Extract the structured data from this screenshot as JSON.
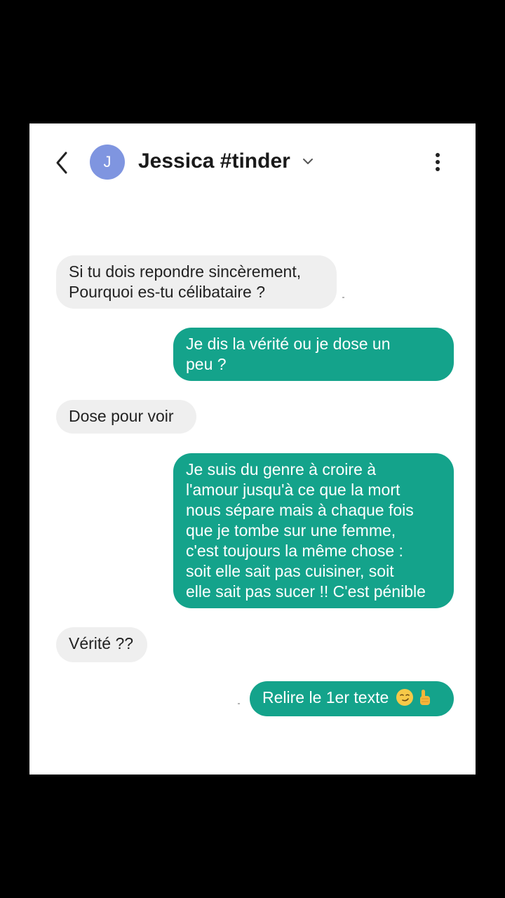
{
  "header": {
    "avatar_initial": "J",
    "contact_name": "Jessica #tinder",
    "back_icon": "chevron-left-icon",
    "dropdown_icon": "chevron-down-icon",
    "more_icon": "more-vertical-icon"
  },
  "colors": {
    "outgoing_bubble": "#14a38b",
    "incoming_bubble": "#efefef",
    "avatar": "#7f95e0",
    "screen_background": "#ffffff",
    "frame_background": "#000000"
  },
  "messages": [
    {
      "direction": "incoming",
      "lines": [
        "Si tu dois repondre sincèrement,",
        "Pourquoi es-tu célibataire ?"
      ]
    },
    {
      "direction": "outgoing",
      "lines": [
        "Je dis la vérité ou je dose un",
        "peu ?"
      ]
    },
    {
      "direction": "incoming",
      "lines": [
        "Dose pour voir"
      ]
    },
    {
      "direction": "outgoing",
      "lines": [
        "Je suis du genre à croire à",
        "l'amour jusqu'à ce que la mort",
        "nous sépare mais à chaque fois",
        "que je tombe sur une femme,",
        "c'est toujours la même chose :",
        "soit elle sait pas cuisiner,  soit",
        "elle sait pas sucer !! C'est pénible"
      ]
    },
    {
      "direction": "incoming",
      "lines": [
        "Vérité ??"
      ]
    },
    {
      "direction": "outgoing",
      "lines": [
        "Relire le 1er texte"
      ],
      "emojis": [
        "smirking-face-emoji",
        "thumbs-up-emoji"
      ]
    }
  ]
}
